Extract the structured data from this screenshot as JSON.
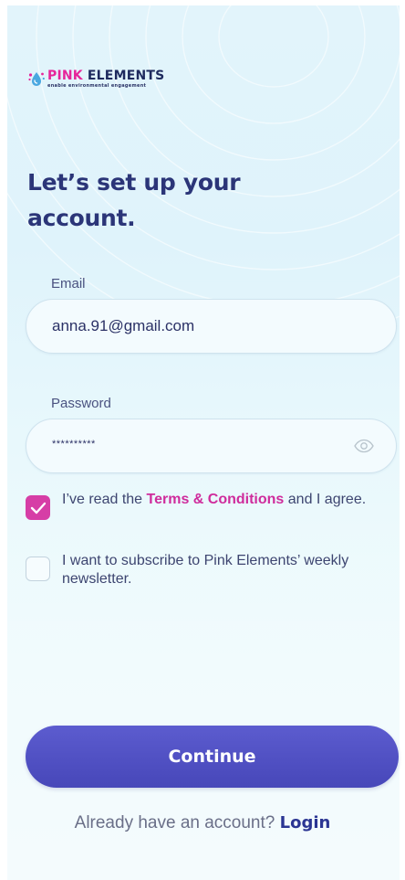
{
  "brand": {
    "name_part1": "PINK",
    "name_part2": "ELEMENTS",
    "tagline": "enable environmental engagement"
  },
  "page": {
    "title": "Let’s set up your account."
  },
  "email": {
    "label": "Email",
    "value": "anna.91@gmail.com"
  },
  "password": {
    "label": "Password",
    "masked_value": "**********",
    "toggle_icon": "eye-icon"
  },
  "consents": {
    "terms": {
      "checked": true,
      "text_before": "I’ve read the ",
      "link_text": "Terms & Conditions",
      "text_after": " and I agree."
    },
    "newsletter": {
      "checked": false,
      "text": "I want to subscribe to Pink Elements’ weekly newsletter."
    }
  },
  "actions": {
    "continue_label": "Continue",
    "login_prompt": "Already have an account? ",
    "login_link": "Login"
  },
  "colors": {
    "brand_pink": "#e6259a",
    "primary_button": "#4f4fc2",
    "heading": "#2b3578",
    "checkbox_checked": "#d63ea6"
  }
}
